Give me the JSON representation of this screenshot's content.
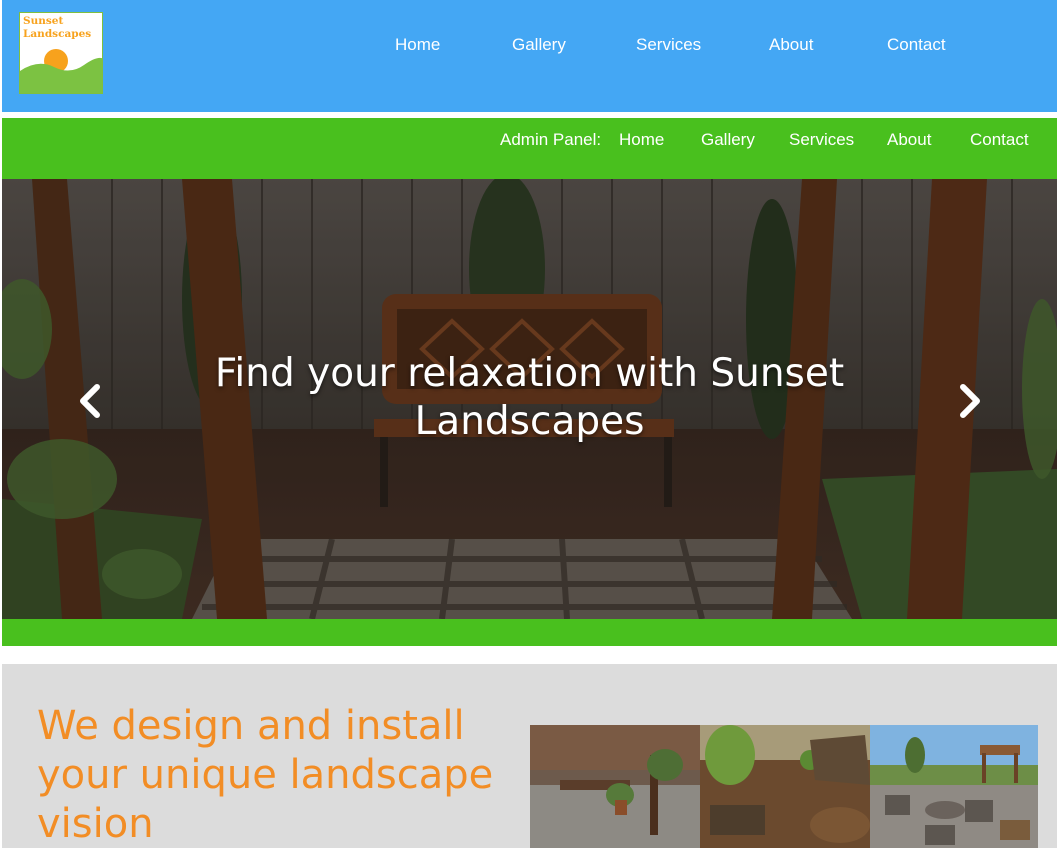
{
  "logo": {
    "text_line1": "Sunset",
    "text_line2": "Landscapes"
  },
  "top_nav": [
    {
      "label": "Home"
    },
    {
      "label": "Gallery"
    },
    {
      "label": "Services"
    },
    {
      "label": "About"
    },
    {
      "label": "Contact"
    }
  ],
  "admin_bar": {
    "label": "Admin Panel:",
    "items": [
      {
        "label": "Home"
      },
      {
        "label": "Gallery"
      },
      {
        "label": "Services"
      },
      {
        "label": "About"
      },
      {
        "label": "Contact"
      }
    ]
  },
  "hero": {
    "caption": "Find your relaxation with Sunset Landscapes",
    "prev_icon": "chevron-left-icon",
    "next_icon": "chevron-right-icon"
  },
  "intro": {
    "heading": "We design and install your unique landscape vision"
  },
  "colors": {
    "header_blue": "#44a7f4",
    "brand_green": "#49c01e",
    "accent_orange": "#f28d25",
    "section_gray": "#dcdcdc"
  }
}
